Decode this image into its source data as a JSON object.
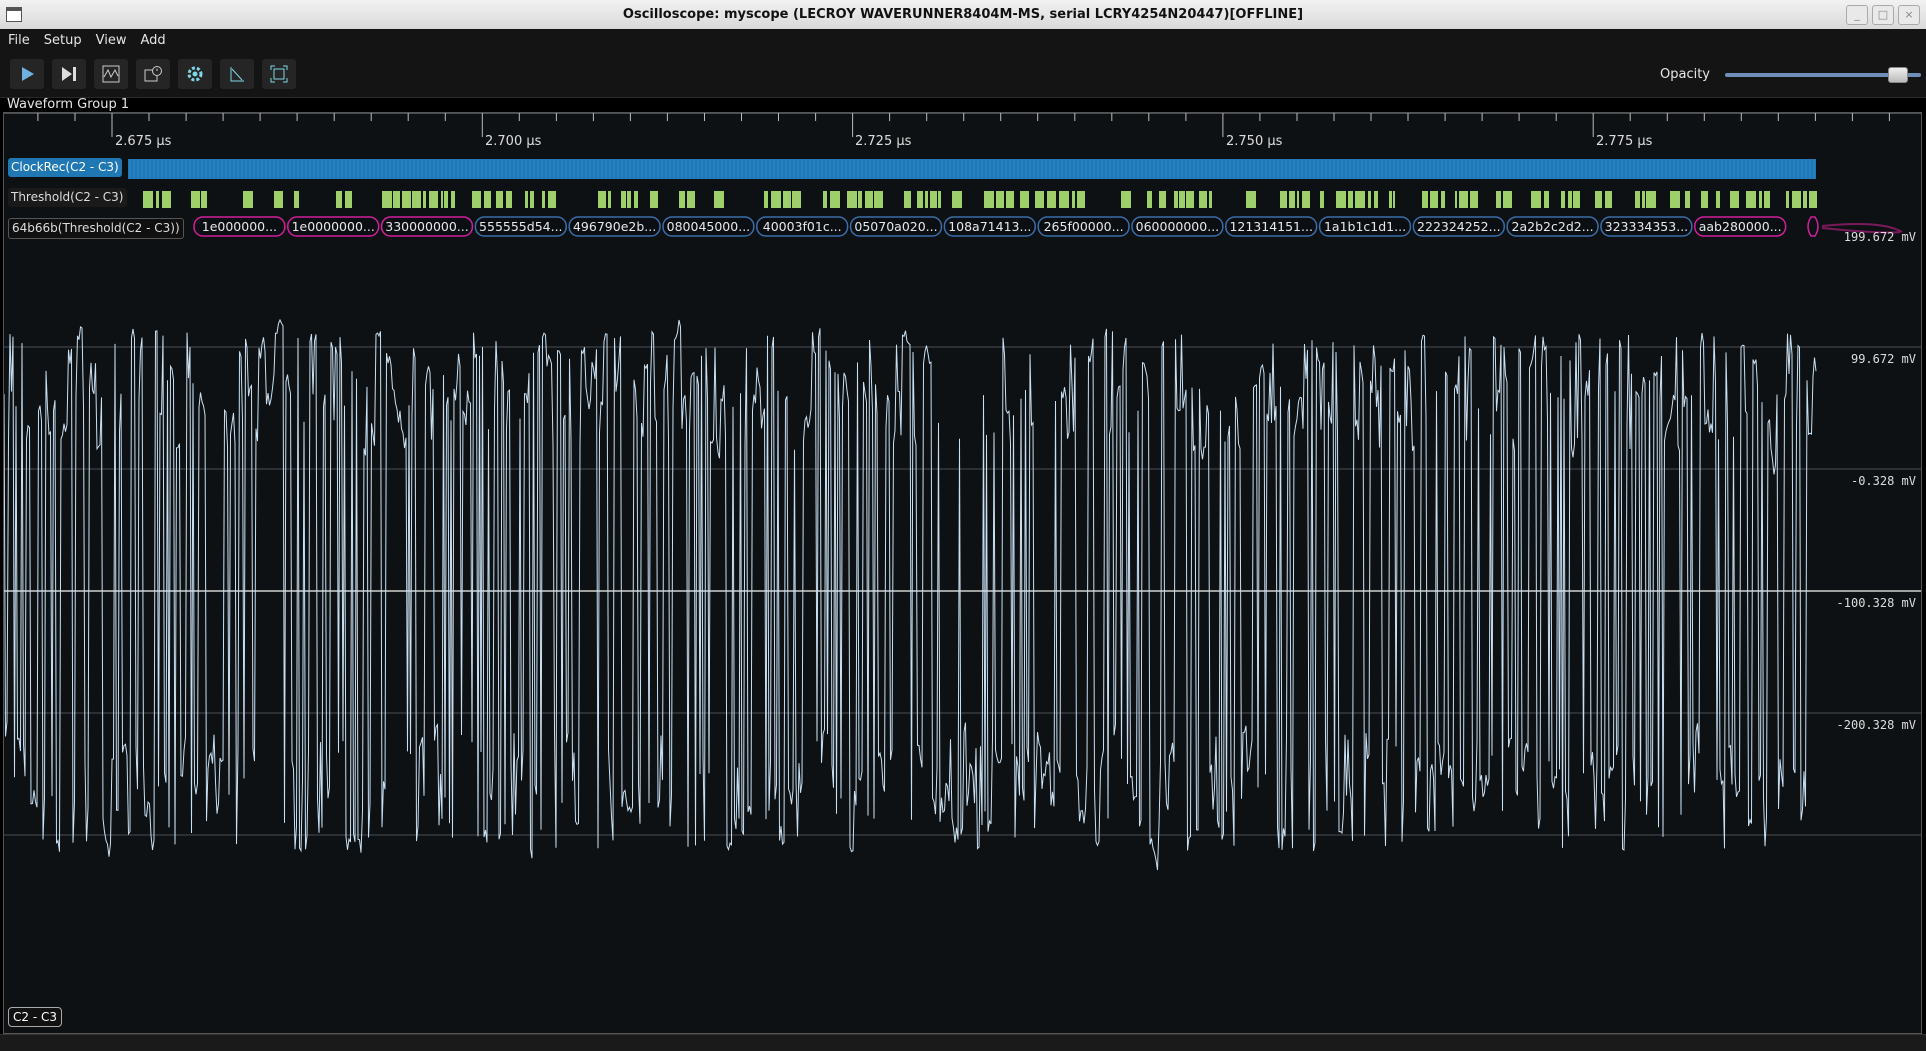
{
  "window": {
    "title": "Oscilloscope: myscope (LECROY WAVERUNNER8404M-MS, serial LCRY4254N20447)[OFFLINE]"
  },
  "menu": [
    "File",
    "Setup",
    "View",
    "Add"
  ],
  "toolbar": {
    "buttons": [
      "play-icon",
      "step-icon",
      "waveform-icon",
      "history-icon",
      "gear-icon",
      "measure-icon",
      "fullscreen-icon"
    ],
    "opacity_label": "Opacity",
    "opacity_value": 0.88
  },
  "group": {
    "title": "Waveform Group 1"
  },
  "timeline": {
    "labels": [
      "2.675 µs",
      "2.700 µs",
      "2.725 µs",
      "2.750 µs",
      "2.775 µs"
    ]
  },
  "rows": {
    "clock_label": "ClockRec(C2 - C3)",
    "threshold_label": "Threshold(C2 - C3)",
    "protocol_label": "64b66b(Threshold(C2 - C3))",
    "packets": [
      {
        "text": "1e000000...",
        "type": "ctrl"
      },
      {
        "text": "1e0000000...",
        "type": "ctrl"
      },
      {
        "text": "330000000...",
        "type": "ctrl"
      },
      {
        "text": "555555d54...",
        "type": "data"
      },
      {
        "text": "496790e2b...",
        "type": "data"
      },
      {
        "text": "080045000...",
        "type": "data"
      },
      {
        "text": "40003f01c...",
        "type": "data"
      },
      {
        "text": "05070a020...",
        "type": "data"
      },
      {
        "text": "108a71413...",
        "type": "data"
      },
      {
        "text": "265f00000...",
        "type": "data"
      },
      {
        "text": "060000000...",
        "type": "data"
      },
      {
        "text": "121314151...",
        "type": "data"
      },
      {
        "text": "1a1b1c1d1...",
        "type": "data"
      },
      {
        "text": "222324252...",
        "type": "data"
      },
      {
        "text": "2a2b2c2d2...",
        "type": "data"
      },
      {
        "text": "323334353...",
        "type": "data"
      },
      {
        "text": "aab280000...",
        "type": "ctrl"
      }
    ]
  },
  "analog": {
    "channel": "C2 - C3",
    "grid_labels": [
      "199.672 mV",
      "99.672 mV",
      "-0.328 mV",
      "-100.328 mV",
      "-200.328 mV"
    ]
  },
  "colors": {
    "clock": "#1f77b4",
    "threshold": "#9fcf6a",
    "ctrl_packet": "#d21e9c",
    "data_packet": "#3a6ea8",
    "waveform": "#c9e0f2"
  }
}
